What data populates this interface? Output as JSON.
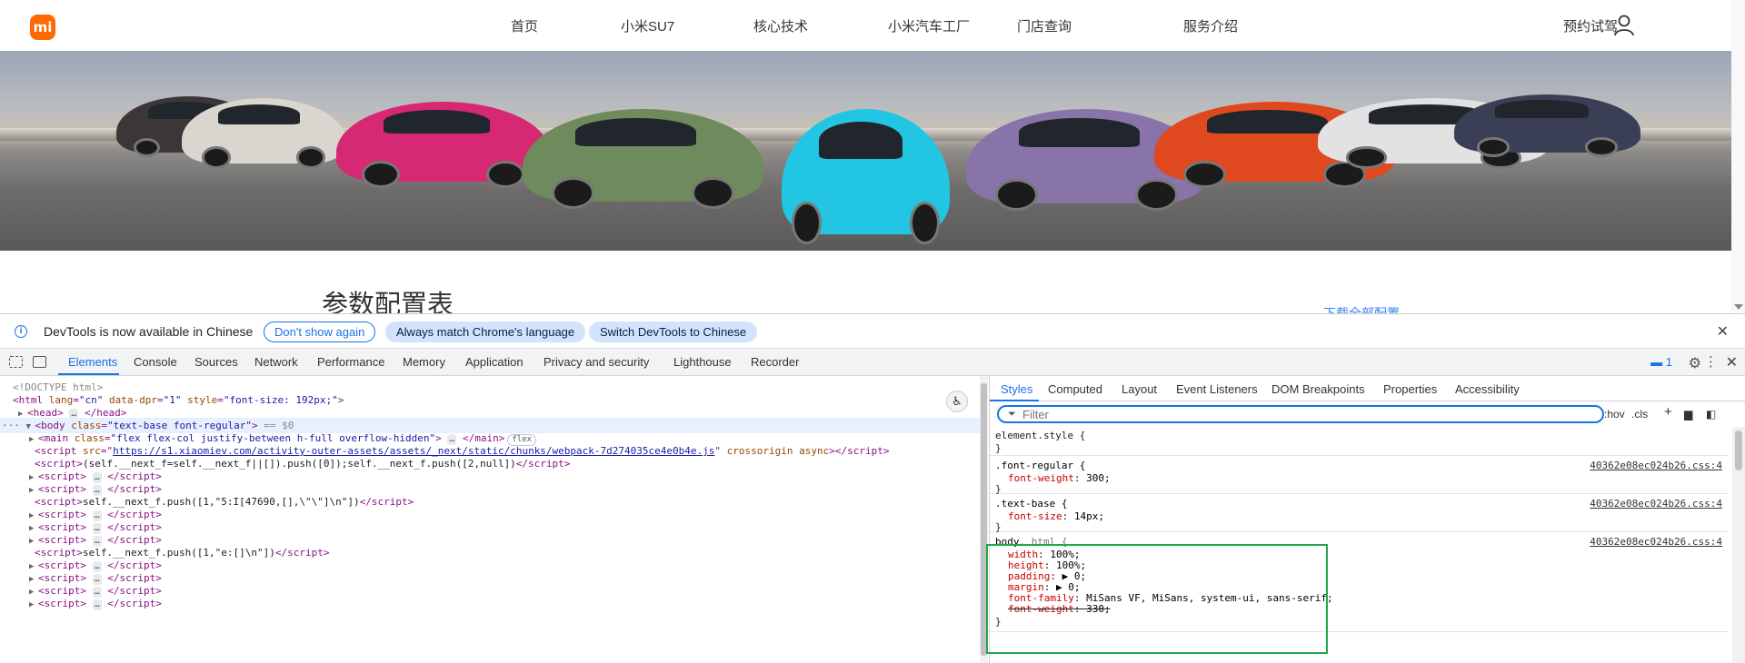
{
  "site": {
    "logo": "mi",
    "nav": [
      "首页",
      "小米SU7",
      "核心技术",
      "小米汽车工厂",
      "门店查询",
      "服务介绍"
    ],
    "test_drive": "预约试驾",
    "section_title": "参数配置表",
    "download_link": "下载全部配置"
  },
  "devtools": {
    "infobar": {
      "text": "DevTools is now available in Chinese",
      "dont_show": "Don't show again",
      "always_match": "Always match Chrome's language",
      "switch": "Switch DevTools to Chinese",
      "close": "✕"
    },
    "tabs": [
      "Elements",
      "Console",
      "Sources",
      "Network",
      "Performance",
      "Memory",
      "Application",
      "Privacy and security",
      "Lighthouse",
      "Recorder"
    ],
    "issues_count": "1",
    "elements": {
      "doctype": "<!DOCTYPE html>",
      "html_tag": "html",
      "html_attrs": [
        {
          "name": "lang",
          "value": "\"cn\""
        },
        {
          "name": "data-dpr",
          "value": "\"1\""
        },
        {
          "name": "style",
          "value": "\"font-size: 192px;\""
        }
      ],
      "head": "head",
      "body_class": "\"text-base font-regular\"",
      "body_eq": "== $0",
      "main_class": "\"flex flex-col justify-between h-full overflow-hidden\"",
      "flex_badge": "flex",
      "script_src_attr": "src",
      "script_src": "https://s1.xiaomiev.com/activity-outer-assets/assets/_next/static/chunks/webpack-7d274035ce4e0b4e.js",
      "script_crossorigin": "crossorigin async",
      "script_inline1": "(self.__next_f=self.__next_f||[]).push([0]);self.__next_f.push([2,null])",
      "script_inline2": "self.__next_f.push([1,\"5:I[47690,[],\\\"\\\"]\\n\"])",
      "script_inline3": "self.__next_f.push([1,\"e:[]\\n\"])",
      "script": "script",
      "ellipsis": "…"
    },
    "styles": {
      "tabs": [
        "Styles",
        "Computed",
        "Layout",
        "Event Listeners",
        "DOM Breakpoints",
        "Properties",
        "Accessibility"
      ],
      "filter_placeholder": "Filter",
      "hov": ":hov",
      "cls": ".cls",
      "rules": [
        {
          "selector": "element.style {",
          "close": "}",
          "props": [],
          "source": ""
        },
        {
          "selector": ".font-regular {",
          "close": "}",
          "props": [
            {
              "name": "font-weight",
              "value": "300;"
            }
          ],
          "source": "40362e08ec024b26.css:4"
        },
        {
          "selector": ".text-base {",
          "close": "}",
          "props": [
            {
              "name": "font-size",
              "value": "14px;"
            }
          ],
          "source": "40362e08ec024b26.css:4"
        },
        {
          "selector_main": "body",
          "selector_rest": ", html {",
          "close": "}",
          "props": [
            {
              "name": "width",
              "value": "100%;"
            },
            {
              "name": "height",
              "value": "100%;"
            },
            {
              "name": "padding",
              "value": "▶ 0;"
            },
            {
              "name": "margin",
              "value": "▶ 0;"
            },
            {
              "name": "font-family",
              "value": "MiSans VF, MiSans, system-ui, sans-serif;"
            },
            {
              "name": "font-weight",
              "value": "330;"
            }
          ],
          "source": "40362e08ec024b26.css:4"
        }
      ]
    }
  },
  "colors": {
    "accent": "#1a73e8",
    "brand": "#ff6900",
    "highlight": "#22a846"
  }
}
